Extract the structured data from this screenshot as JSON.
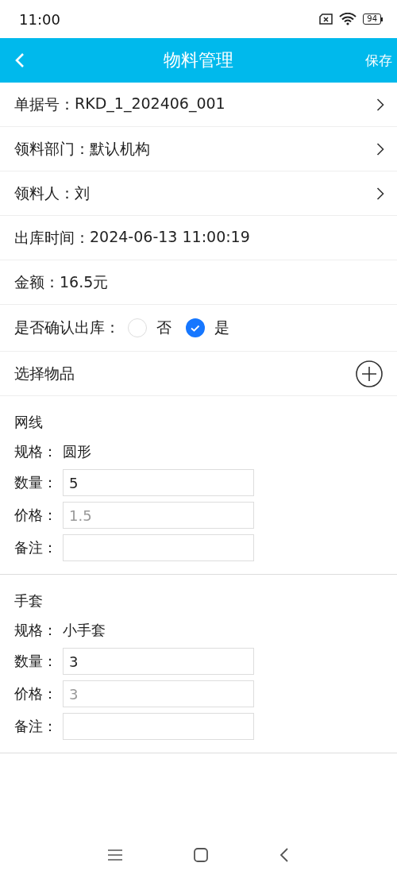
{
  "status_bar": {
    "time": "11:00",
    "battery": "94"
  },
  "nav_bar": {
    "title": "物料管理",
    "action": "保存"
  },
  "rows": [
    {
      "kind": "link",
      "label": "单据号：",
      "value": "RKD_1_202406_001"
    },
    {
      "kind": "link",
      "label": "领料部门：",
      "value": "默认机构"
    },
    {
      "kind": "link",
      "label": "领料人：",
      "value": "刘"
    },
    {
      "kind": "text",
      "label": "出库时间：",
      "value": "2024-06-13 11:00:19"
    },
    {
      "kind": "text",
      "label": "金额：",
      "value": "16.5元"
    }
  ],
  "confirm": {
    "label": "是否确认出库：",
    "options": [
      {
        "label": "否",
        "selected": false
      },
      {
        "label": "是",
        "selected": true
      }
    ]
  },
  "select_items": {
    "label": "选择物品"
  },
  "items": [
    {
      "name": "网线",
      "spec_label": "规格：",
      "spec": "圆形",
      "fields": [
        {
          "label": "数量：",
          "value": "5"
        },
        {
          "label": "价格：",
          "placeholder": "1.5"
        },
        {
          "label": "备注："
        }
      ]
    },
    {
      "name": "手套",
      "spec_label": "规格：",
      "spec": "小手套",
      "fields": [
        {
          "label": "数量：",
          "value": "3"
        },
        {
          "label": "价格：",
          "placeholder": "3"
        },
        {
          "label": "备注："
        }
      ]
    }
  ]
}
